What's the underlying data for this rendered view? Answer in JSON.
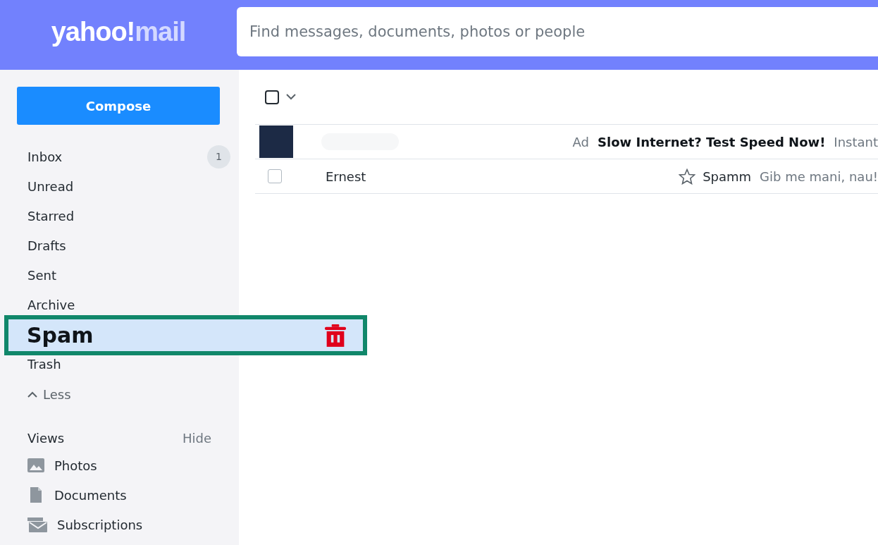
{
  "header": {
    "logo_main": "yahoo!",
    "logo_sub": "mail",
    "search": {
      "placeholder": "Find messages, documents, photos or people"
    }
  },
  "sidebar": {
    "compose": "Compose",
    "folders": [
      {
        "label": "Inbox",
        "badge": "1",
        "highlighted": false
      },
      {
        "label": "Unread",
        "highlighted": false
      },
      {
        "label": "Starred",
        "highlighted": false
      },
      {
        "label": "Drafts",
        "highlighted": false
      },
      {
        "label": "Sent",
        "highlighted": false
      },
      {
        "label": "Archive",
        "highlighted": false
      },
      {
        "label": "Spam",
        "highlighted": true
      },
      {
        "label": "Trash",
        "highlighted": false
      }
    ],
    "less": "Less",
    "views": {
      "title": "Views",
      "toggle": "Hide",
      "items": [
        {
          "label": "Photos",
          "kind": "photos"
        },
        {
          "label": "Documents",
          "kind": "documents"
        },
        {
          "label": "Subscriptions",
          "kind": "subscriptions"
        }
      ]
    }
  },
  "messages": {
    "select_all": {
      "checked": false
    },
    "rows": [
      {
        "kind": "ad",
        "tag": "Ad",
        "subject": "Slow Internet? Test Speed Now!",
        "snippet": "Instant"
      },
      {
        "kind": "mail",
        "checked": false,
        "starred": false,
        "sender": "Ernest",
        "subject": "Spamm",
        "snippet": "Gib me mani, nau!"
      }
    ]
  }
}
